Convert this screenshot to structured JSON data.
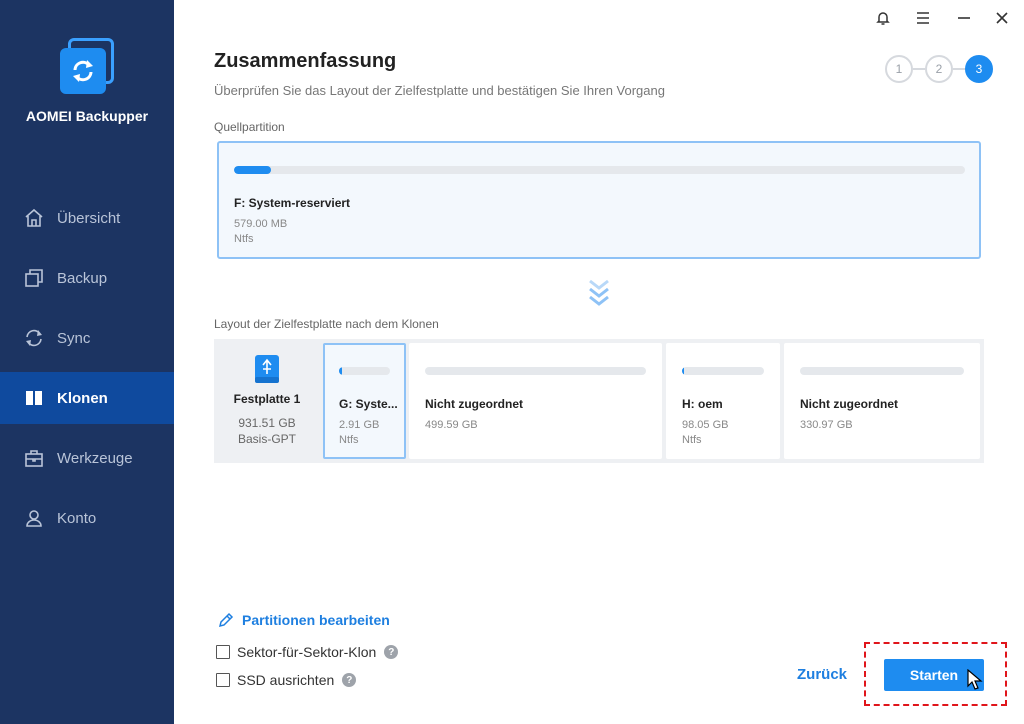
{
  "app": {
    "name": "AOMEI Backupper"
  },
  "sidebar": {
    "items": [
      {
        "label": "Übersicht",
        "icon": "home-icon",
        "active": false
      },
      {
        "label": "Backup",
        "icon": "backup-icon",
        "active": false
      },
      {
        "label": "Sync",
        "icon": "sync-icon",
        "active": false
      },
      {
        "label": "Klonen",
        "icon": "clone-icon",
        "active": true
      },
      {
        "label": "Werkzeuge",
        "icon": "toolbox-icon",
        "active": false
      },
      {
        "label": "Konto",
        "icon": "user-icon",
        "active": false
      }
    ]
  },
  "window_controls": [
    "bell-icon",
    "menu-icon",
    "minimize-icon",
    "close-icon"
  ],
  "header": {
    "title": "Zusammenfassung",
    "subtitle": "Überprüfen Sie das Layout der Zielfestplatte und bestätigen Sie Ihren Vorgang",
    "steps": [
      "1",
      "2",
      "3"
    ],
    "active_step": 3
  },
  "source": {
    "label": "Quellpartition",
    "partition": {
      "name": "F: System-reserviert",
      "size": "579.00 MB",
      "fs": "Ntfs",
      "used_percent": 5
    }
  },
  "target": {
    "label": "Layout der Zielfestplatte nach dem Klonen",
    "disk": {
      "name": "Festplatte 1",
      "size": "931.51 GB",
      "type": "Basis-GPT"
    },
    "partitions": [
      {
        "name": "G: Syste...",
        "size": "2.91 GB",
        "fs": "Ntfs",
        "used_percent": 5
      },
      {
        "name": "Nicht zugeordnet",
        "size": "499.59 GB",
        "fs": "",
        "used_percent": 0
      },
      {
        "name": "H: oem",
        "size": "98.05 GB",
        "fs": "Ntfs",
        "used_percent": 3
      },
      {
        "name": "Nicht zugeordnet",
        "size": "330.97 GB",
        "fs": "",
        "used_percent": 0
      }
    ]
  },
  "options": {
    "edit_partitions": "Partitionen bearbeiten",
    "sector_by_sector": "Sektor-für-Sektor-Klon",
    "ssd_align": "SSD ausrichten",
    "help": "?"
  },
  "buttons": {
    "back": "Zurück",
    "start": "Starten"
  },
  "colors": {
    "sidebar": "#1c3462",
    "active_nav": "#0f4a9e",
    "accent": "#1e8cf0",
    "highlight": "#e0151b"
  }
}
